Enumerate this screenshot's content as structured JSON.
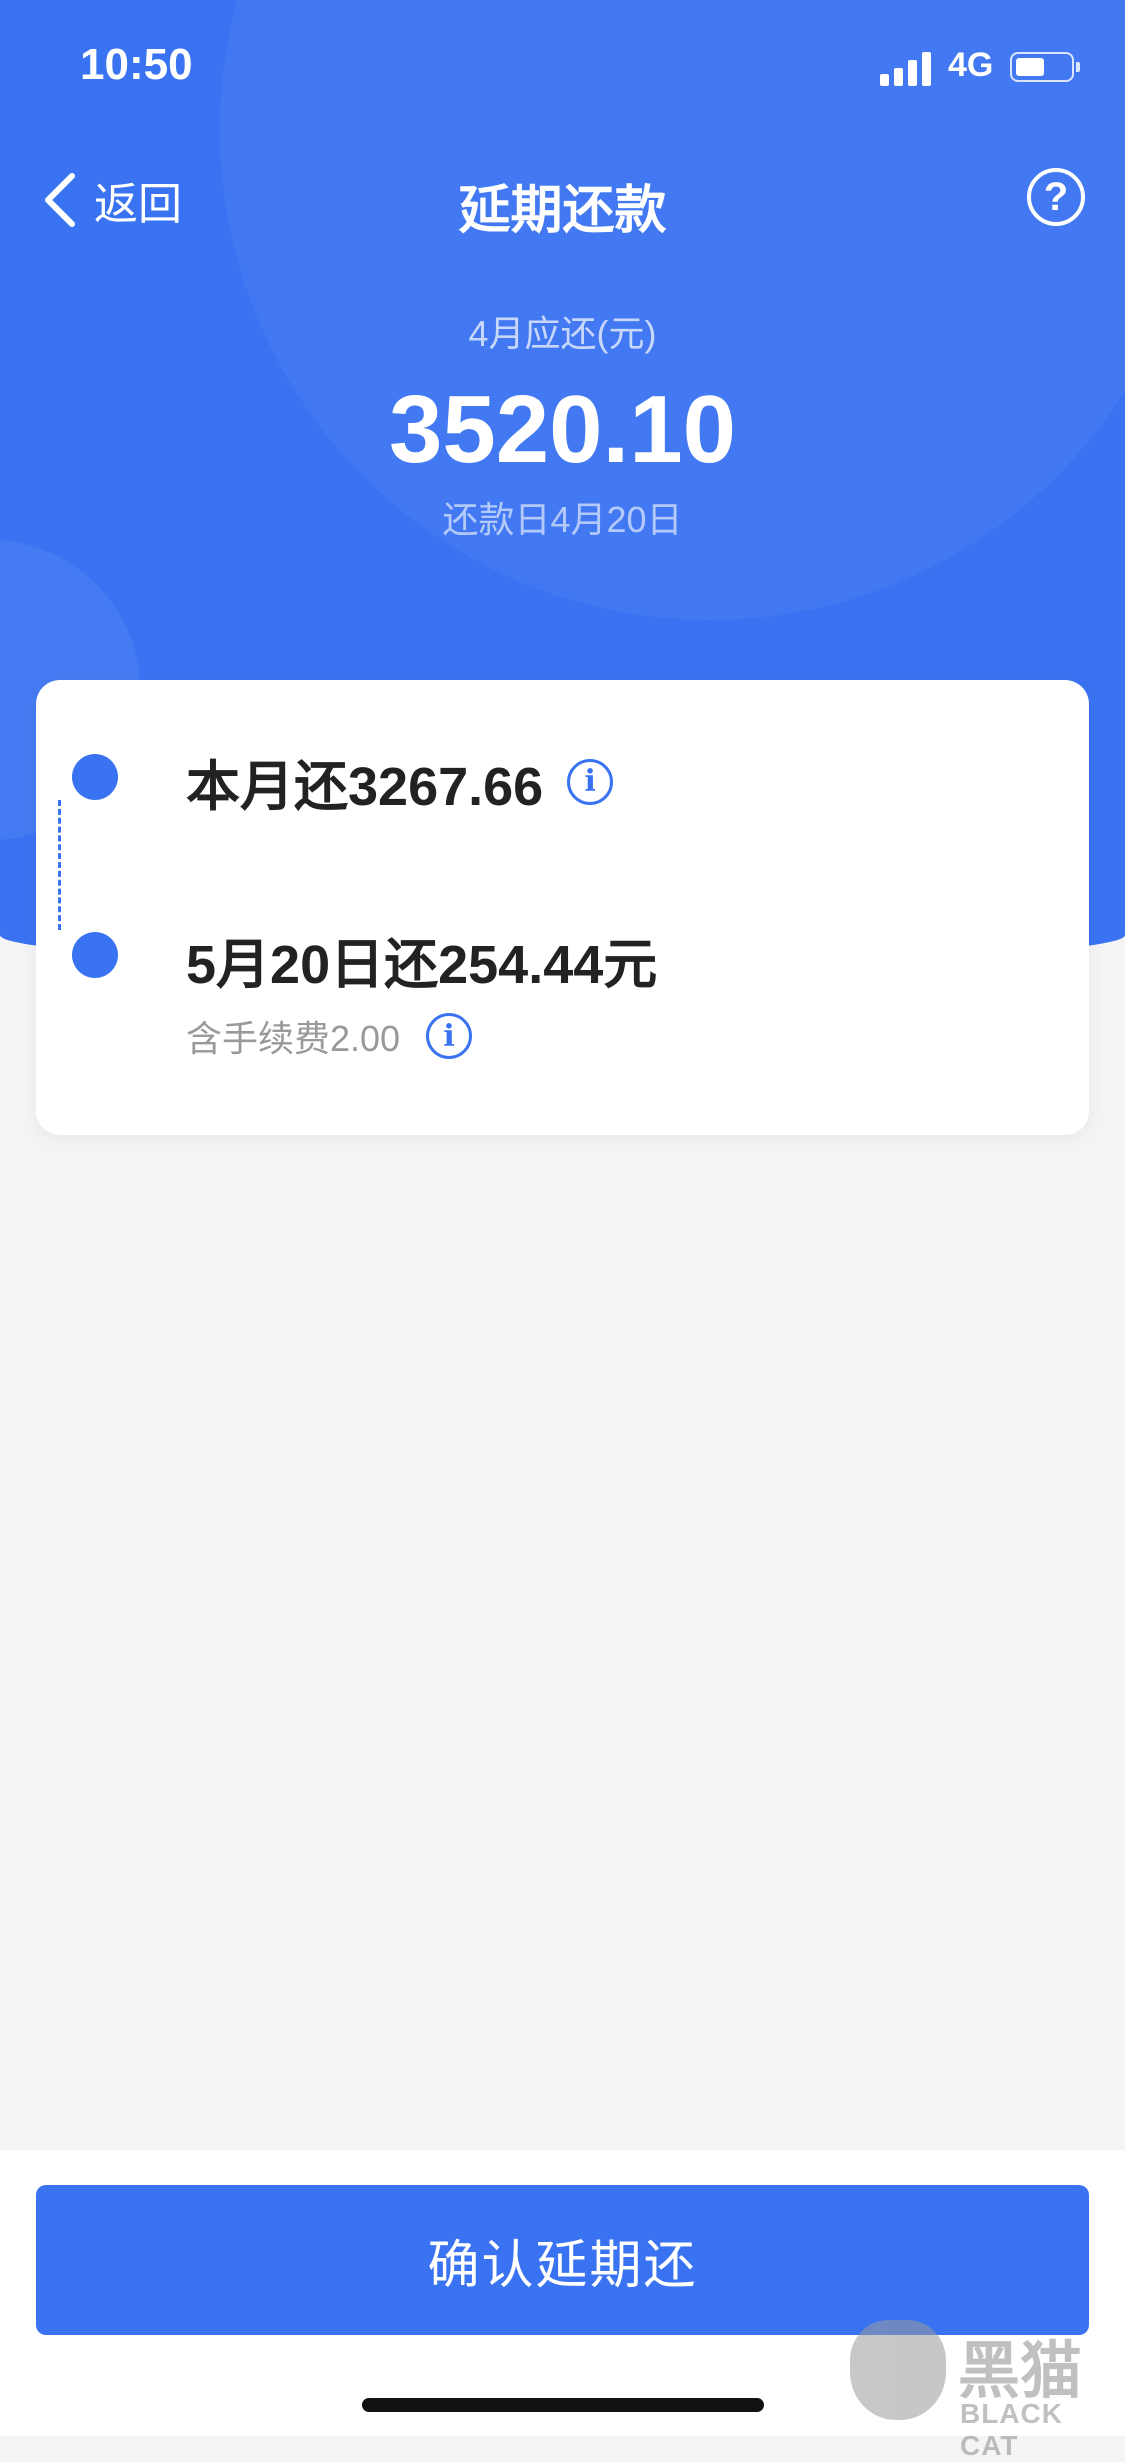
{
  "status_bar": {
    "time": "10:50",
    "network": "4G"
  },
  "nav": {
    "back_label": "返回",
    "title": "延期还款",
    "help_icon": "question-circle-icon"
  },
  "summary": {
    "label": "4月应还(元)",
    "amount": "3520.10",
    "due_date": "还款日4月20日"
  },
  "plan": {
    "items": [
      {
        "text": "本月还3267.66"
      },
      {
        "text": "5月20日还254.44元",
        "subtext": "含手续费2.00"
      }
    ],
    "accent": "#3a73f2"
  },
  "footer": {
    "confirm_label": "确认延期还"
  },
  "watermark": {
    "cn": "黑猫",
    "en": "BLACK CAT"
  }
}
